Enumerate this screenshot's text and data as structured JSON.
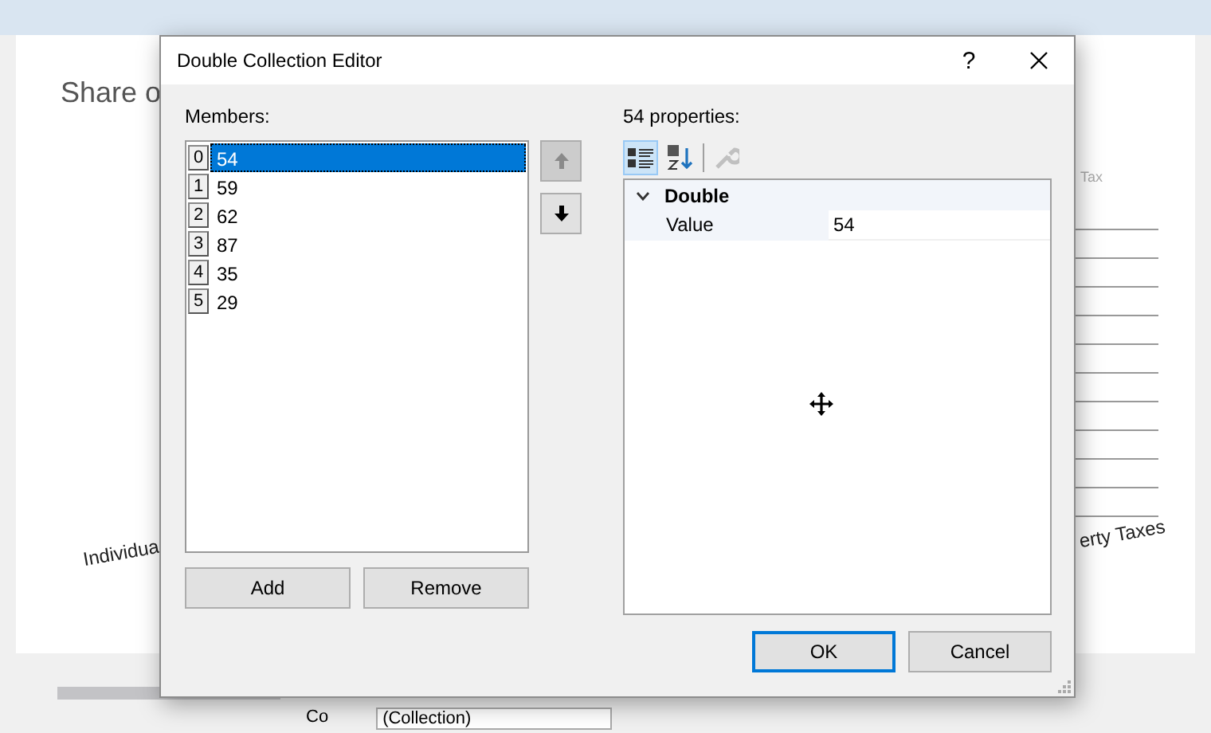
{
  "designer": {
    "heading": "Share o",
    "legend_label": "Tax",
    "axis_labels": [
      "Individua",
      "erty Taxes"
    ],
    "property_row": {
      "name": "Co",
      "value": "(Collection)"
    }
  },
  "dialog": {
    "title": "Double Collection Editor",
    "help": "?",
    "members_label": "Members:",
    "members": [
      {
        "index": "0",
        "value": "54",
        "selected": true
      },
      {
        "index": "1",
        "value": "59",
        "selected": false
      },
      {
        "index": "2",
        "value": "62",
        "selected": false
      },
      {
        "index": "3",
        "value": "87",
        "selected": false
      },
      {
        "index": "4",
        "value": "35",
        "selected": false
      },
      {
        "index": "5",
        "value": "29",
        "selected": false
      }
    ],
    "move_up": {
      "disabled": true
    },
    "move_down": {
      "disabled": false
    },
    "add": "Add",
    "remove": "Remove",
    "properties_label": "54 properties:",
    "toolbar": {
      "categorized": {
        "selected": true
      },
      "alphabetical": {
        "selected": false
      },
      "property_pages": {
        "disabled": true
      }
    },
    "category": {
      "name": "Double",
      "expanded": true
    },
    "properties": [
      {
        "name": "Value",
        "value": "54"
      }
    ],
    "ok": {
      "label": "OK",
      "default": true
    },
    "cancel": {
      "label": "Cancel",
      "default": false
    }
  }
}
